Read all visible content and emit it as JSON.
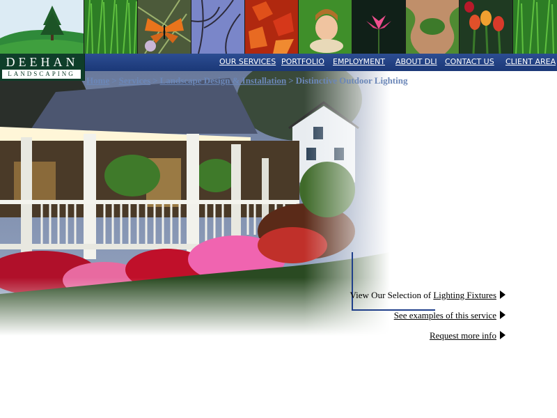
{
  "logo": {
    "name": "DEEHAN",
    "tagline": "LANDSCAPING"
  },
  "strip": {
    "tiles": [
      "tree-hill-photo",
      "grass-photo",
      "butterfly-photo",
      "branches-photo",
      "red-leaves-photo",
      "child-on-grass-photo",
      "water-lily-photo",
      "garden-path-photo",
      "tulips-photo",
      "grass-photo"
    ]
  },
  "nav": {
    "items": [
      {
        "label": "OUR SERVICES"
      },
      {
        "label": "PORTFOLIO"
      },
      {
        "label": "EMPLOYMENT"
      },
      {
        "label": "ABOUT DLI"
      },
      {
        "label": "CONTACT US"
      },
      {
        "label": "CLIENT AREA"
      }
    ]
  },
  "breadcrumb": {
    "items": [
      "Home",
      "Services",
      "Landscape Design & Installation",
      "Distinctive Outdoor Lighting"
    ],
    "separator": ">"
  },
  "hero": {
    "subject": "lit-porch-house-photo"
  },
  "links": {
    "fixtures_prefix": "View Our Selection of ",
    "fixtures_link": "Lighting Fixtures",
    "examples": "See examples of this service",
    "request": "Request more info"
  },
  "colors": {
    "nav_bg": "#1b3877",
    "logo_bg": "#0f3e2a",
    "breadcrumb": "#6b87b8",
    "accent_line": "#1f3f8a"
  }
}
